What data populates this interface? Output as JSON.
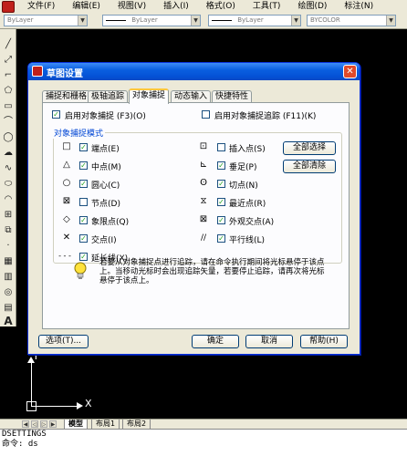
{
  "menubar": {
    "items": [
      "文件(F)",
      "编辑(E)",
      "视图(V)",
      "插入(I)",
      "格式(O)",
      "工具(T)",
      "绘图(D)",
      "标注(N)"
    ]
  },
  "toolbar": {
    "layer_combo": "ByLayer",
    "linetype_combo": "ByLayer",
    "lineweight_combo": "ByLayer",
    "plotstyle_combo": "BYCOLOR"
  },
  "dialog": {
    "title": "草图设置",
    "close_glyph": "✕",
    "tabs": [
      "捕捉和栅格",
      "极轴追踪",
      "对象捕捉",
      "动态输入",
      "快捷特性"
    ],
    "enable_osnap": "启用对象捕捉 (F3)(O)",
    "enable_osnap_tracking": "启用对象捕捉追踪 (F11)(K)",
    "group_title": "对象捕捉模式",
    "modes_left": [
      {
        "symbol": "□",
        "label": "端点(E)",
        "checked": true
      },
      {
        "symbol": "△",
        "label": "中点(M)",
        "checked": true
      },
      {
        "symbol": "○",
        "label": "圆心(C)",
        "checked": true
      },
      {
        "symbol": "⊠",
        "label": "节点(D)",
        "checked": false
      },
      {
        "symbol": "◇",
        "label": "象限点(Q)",
        "checked": true
      },
      {
        "symbol": "✕",
        "label": "交点(I)",
        "checked": true
      },
      {
        "symbol": "- - -",
        "label": "延长线(X)",
        "checked": true
      }
    ],
    "modes_right": [
      {
        "symbol": "⊡",
        "label": "插入点(S)",
        "checked": false
      },
      {
        "symbol": "⊾",
        "label": "垂足(P)",
        "checked": true
      },
      {
        "symbol": "ʘ",
        "label": "切点(N)",
        "checked": true
      },
      {
        "symbol": "⧖",
        "label": "最近点(R)",
        "checked": true
      },
      {
        "symbol": "⊠",
        "label": "外观交点(A)",
        "checked": true
      },
      {
        "symbol": "//",
        "label": "平行线(L)",
        "checked": true
      }
    ],
    "select_all": "全部选择",
    "clear_all": "全部清除",
    "info_text": "若要从对象捕捉点进行追踪，请在命令执行期间将光标悬停于该点上。当移动光标时会出现追踪矢量，若要停止追踪，请再次将光标悬停于该点上。",
    "options_button": "选项(T)...",
    "ok_button": "确定",
    "cancel_button": "取消",
    "help_button": "帮助(H)"
  },
  "canvas": {
    "ucs_x_label": "X",
    "ucs_y_label": "Y"
  },
  "layout_tabs": [
    "模型",
    "布局1",
    "布局2"
  ],
  "command_line": {
    "history": "DSETTINGS",
    "prompt": "命令: ds"
  },
  "colors": {
    "title_blue": "#0a5fe0",
    "canvas": "#000000",
    "group_title": "#0046d5"
  }
}
